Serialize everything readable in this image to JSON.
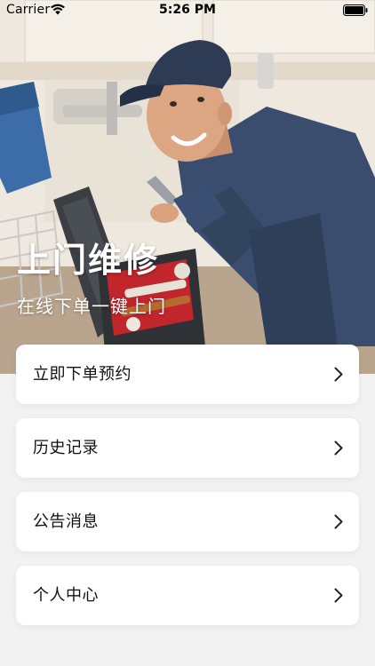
{
  "status_bar": {
    "carrier": "Carrier",
    "time": "5:26 PM",
    "wifi_icon": "wifi-icon",
    "battery_icon": "battery-icon"
  },
  "hero": {
    "title": "上门维修",
    "subtitle": "在线下单一键上门",
    "image": "plumber-photo"
  },
  "menu": {
    "items": [
      {
        "label": "立即下单预约",
        "icon": "chevron-right-icon"
      },
      {
        "label": "历史记录",
        "icon": "chevron-right-icon"
      },
      {
        "label": "公告消息",
        "icon": "chevron-right-icon"
      },
      {
        "label": "个人中心",
        "icon": "chevron-right-icon"
      }
    ]
  },
  "colors": {
    "background": "#f2f2f2",
    "card": "#ffffff",
    "text": "#111111",
    "hero_text": "#ffffff"
  }
}
